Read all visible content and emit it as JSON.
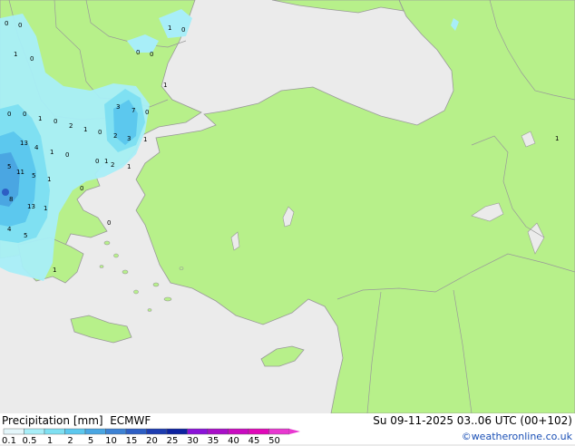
{
  "product": {
    "variable": "Precipitation [mm]",
    "model": "ECMWF"
  },
  "valid_time": "Su 09-11-2025 03..06 UTC (00+102)",
  "credit": "©weatheronline.co.uk",
  "legend": {
    "ticks": [
      "0.1",
      "0.5",
      "1",
      "2",
      "5",
      "10",
      "15",
      "20",
      "25",
      "30",
      "35",
      "40",
      "45",
      "50"
    ],
    "colors": [
      "#e4f6fa",
      "#a8eef8",
      "#7fe0f2",
      "#5cc8ee",
      "#4aa6e2",
      "#3d82d4",
      "#2d5ec4",
      "#1d3cb0",
      "#0d22a0",
      "#8a12d8",
      "#a80fc8",
      "#c90bc0",
      "#e009b8",
      "#e838d0"
    ]
  },
  "map_colors": {
    "sea": "#ebebeb",
    "land": "#b7f08a",
    "border": "#999999"
  },
  "station_values": [
    "0",
    "0",
    "1",
    "0",
    "1",
    "0",
    "0",
    "0",
    "1",
    "0",
    "0",
    "1",
    "2",
    "1",
    "0",
    "0",
    "3",
    "7",
    "0",
    "13",
    "2",
    "1",
    "4",
    "1",
    "0",
    "3",
    "1",
    "2",
    "1",
    "0",
    "5",
    "11",
    "1",
    "5",
    "8",
    "13",
    "0",
    "0",
    "4",
    "5",
    "1",
    "1",
    "1"
  ]
}
